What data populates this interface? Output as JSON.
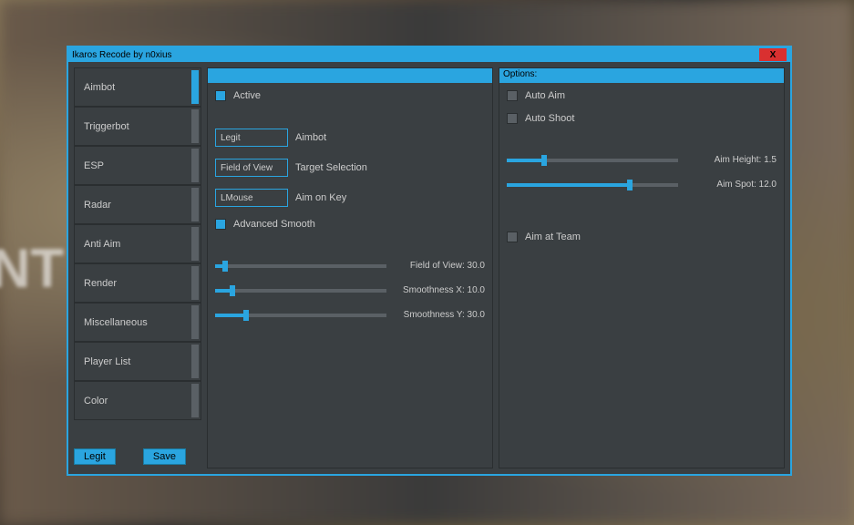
{
  "window": {
    "title": "Ikaros Recode by n0xius",
    "close": "X"
  },
  "sidebar": {
    "tabs": [
      {
        "label": "Aimbot",
        "active": true
      },
      {
        "label": "Triggerbot",
        "active": false
      },
      {
        "label": "ESP",
        "active": false
      },
      {
        "label": "Radar",
        "active": false
      },
      {
        "label": "Anti Aim",
        "active": false
      },
      {
        "label": "Render",
        "active": false
      },
      {
        "label": "Miscellaneous",
        "active": false
      },
      {
        "label": "Player List",
        "active": false
      },
      {
        "label": "Color",
        "active": false
      }
    ],
    "buttons": {
      "legit": "Legit",
      "save": "Save"
    }
  },
  "left_panel": {
    "header": "",
    "active": {
      "label": "Active",
      "checked": true
    },
    "aimbot_mode": {
      "value": "Legit",
      "label": "Aimbot"
    },
    "target_sel": {
      "value": "Field of View",
      "label": "Target Selection"
    },
    "aim_key": {
      "value": "LMouse",
      "label": "Aim on Key"
    },
    "adv_smooth": {
      "label": "Advanced Smooth",
      "checked": true
    },
    "sliders": [
      {
        "label": "Field of View: 30.0",
        "percent": 6
      },
      {
        "label": "Smoothness X: 10.0",
        "percent": 10
      },
      {
        "label": "Smoothness Y: 30.0",
        "percent": 18
      }
    ]
  },
  "right_panel": {
    "header": "Options:",
    "auto_aim": {
      "label": "Auto Aim",
      "checked": false
    },
    "auto_shoot": {
      "label": "Auto Shoot",
      "checked": false
    },
    "sliders": [
      {
        "label": "Aim Height: 1.5",
        "percent": 22
      },
      {
        "label": "Aim Spot: 12.0",
        "percent": 72
      }
    ],
    "aim_team": {
      "label": "Aim at Team",
      "checked": false
    }
  }
}
